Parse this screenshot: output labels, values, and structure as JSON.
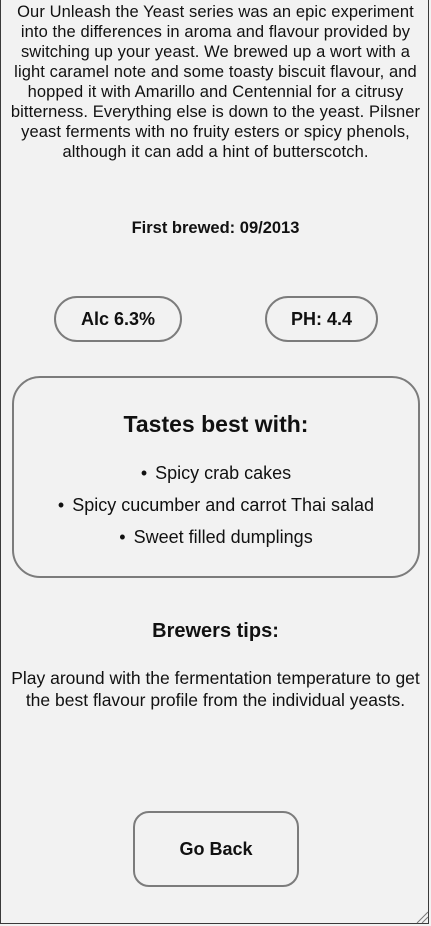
{
  "beer": {
    "description": "Our Unleash the Yeast series was an epic experiment into the differences in aroma and flavour provided by switching up your yeast. We brewed up a wort with a light caramel note and some toasty biscuit flavour, and hopped it with Amarillo and Centennial for a citrusy bitterness. Everything else is down to the yeast. Pilsner yeast ferments with no fruity esters or spicy phenols, although it can add a hint of butterscotch.",
    "first_brewed": "First brewed: 09/2013",
    "abv": "Alc 6.3%",
    "ph": "PH: 4.4"
  },
  "tastes": {
    "title": "Tastes best with:",
    "items": [
      "Spicy crab cakes",
      "Spicy cucumber and carrot Thai salad",
      "Sweet filled dumplings"
    ]
  },
  "tips": {
    "title": "Brewers tips:",
    "text": "Play around with the fermentation temperature to get the best flavour profile from the individual yeasts."
  },
  "actions": {
    "go_back_label": "Go Back"
  }
}
